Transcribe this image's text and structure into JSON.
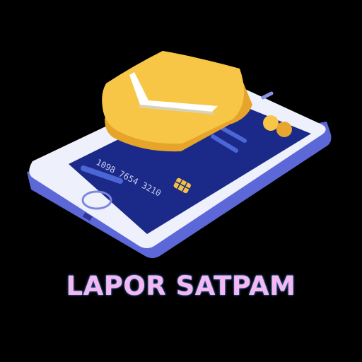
{
  "app": {
    "title": "LAPOR SATPAM"
  },
  "card": {
    "number": "1098 7654 3210"
  },
  "icons": {
    "phone": "smartphone-icon",
    "shield": "shield-check-icon",
    "card": "credit-card-icon",
    "chip": "card-chip-icon"
  },
  "colors": {
    "background": "#000000",
    "phone_body": "#eef0fb",
    "phone_side": "#5d68d8",
    "screen": "#1b2a88",
    "shield": "#f7c646",
    "shield_dark": "#e6a52a",
    "chip": "#f4c142",
    "title": "#f2b8ef"
  }
}
